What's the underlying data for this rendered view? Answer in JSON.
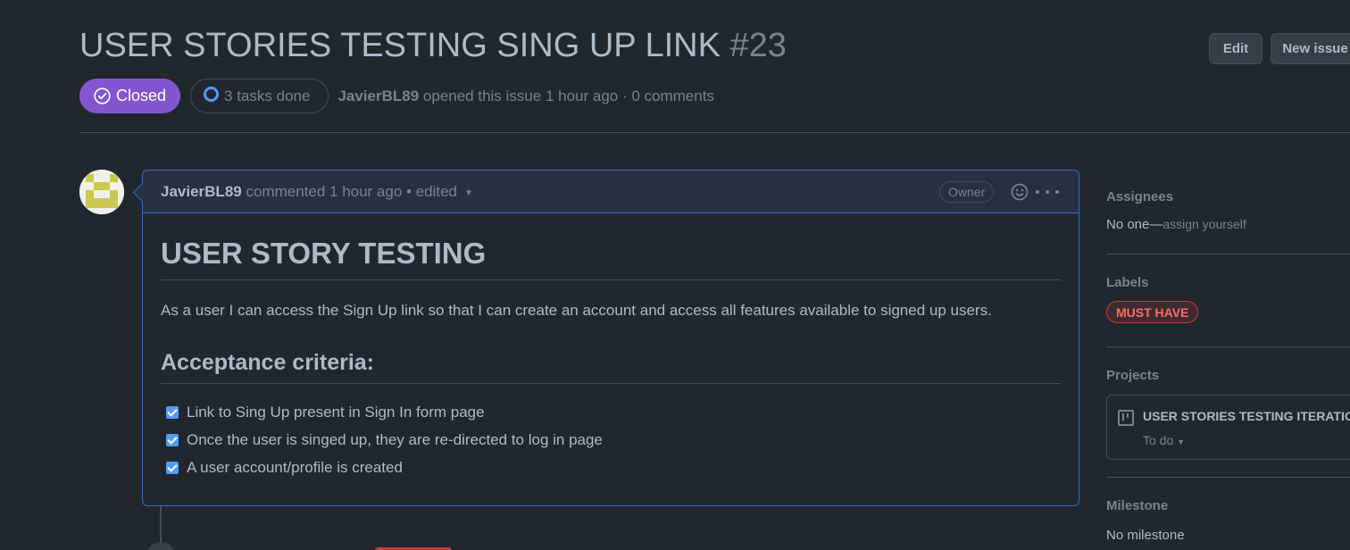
{
  "issue": {
    "title": "USER STORIES TESTING SING UP LINK",
    "number": "#23",
    "state": "Closed",
    "tasks": "3 tasks done",
    "author": "JavierBL89",
    "meta": "opened this issue 1 hour ago · 0 comments"
  },
  "header_buttons": {
    "edit": "Edit",
    "new_issue": "New issue"
  },
  "comment": {
    "author": "JavierBL89",
    "meta": "commented 1 hour ago • edited",
    "role": "Owner",
    "heading": "USER STORY TESTING",
    "paragraph": "As a user I can access the Sign Up link so that I can create an account and access all features available to signed up users.",
    "subheading": "Acceptance criteria:",
    "tasks": [
      {
        "text": "Link to Sing Up present in Sign In form page",
        "checked": true
      },
      {
        "text": "Once the user is singed up, they are re-directed to log in page",
        "checked": true
      },
      {
        "text": "A user account/profile is created",
        "checked": true
      }
    ]
  },
  "sidebar": {
    "assignees": {
      "heading": "Assignees",
      "value": "No one—",
      "action": "assign yourself"
    },
    "labels": {
      "heading": "Labels",
      "items": [
        "MUST HAVE"
      ]
    },
    "projects": {
      "heading": "Projects",
      "name": "USER STORIES TESTING ITERATION",
      "column": "To do"
    },
    "milestone": {
      "heading": "Milestone",
      "value": "No milestone"
    }
  },
  "colors": {
    "background": "#22272e",
    "closed_badge": "#8256d0",
    "accent_blue": "#316dca",
    "label_red": "#c93c37"
  }
}
